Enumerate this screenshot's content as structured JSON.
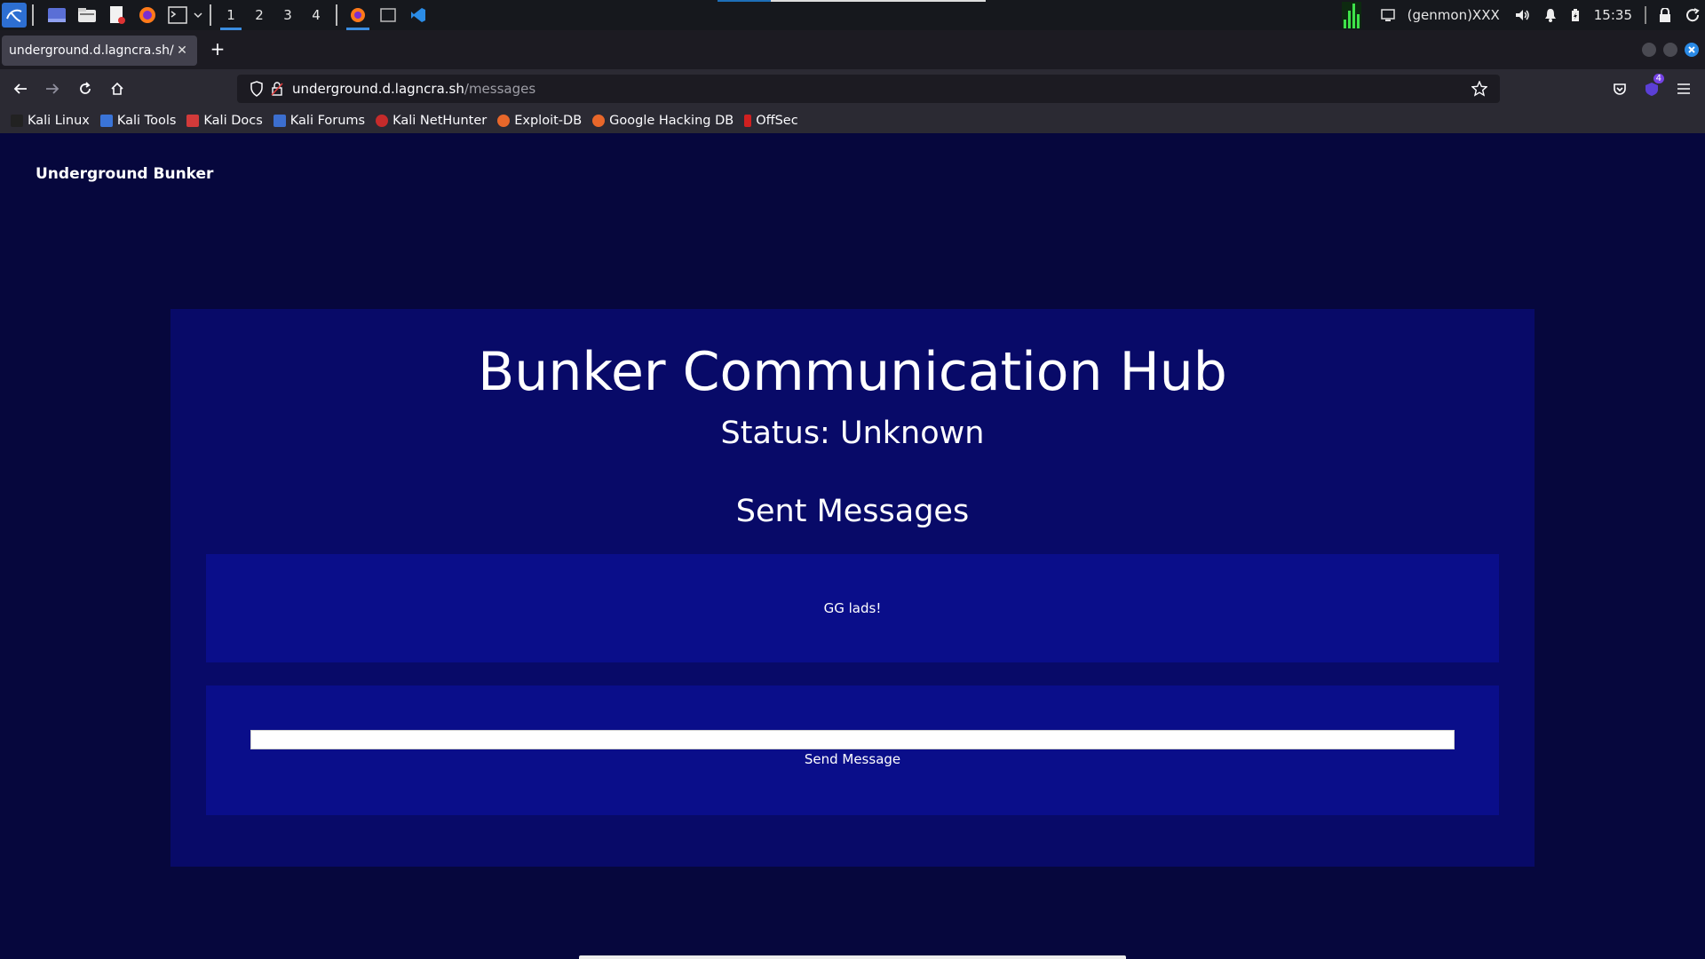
{
  "system_panel": {
    "workspaces": [
      "1",
      "2",
      "3",
      "4"
    ],
    "active_workspace": "1",
    "genmon_label": "(genmon)XXX",
    "clock": "15:35"
  },
  "browser": {
    "tab_title": "underground.d.lagncra.sh/messages",
    "url_host": "underground.d.lagncra.sh",
    "url_path": "/messages",
    "extension_badge": "4",
    "bookmarks": [
      "Kali Linux",
      "Kali Tools",
      "Kali Docs",
      "Kali Forums",
      "Kali NetHunter",
      "Exploit-DB",
      "Google Hacking DB",
      "OffSec"
    ]
  },
  "page": {
    "brand": "Underground Bunker",
    "title": "Bunker Communication Hub",
    "status": "Status: Unknown",
    "sent_heading": "Sent Messages",
    "messages": [
      "GG lads!"
    ],
    "input_value": "",
    "send_label": "Send Message"
  },
  "colors": {
    "page_bg": "#06073d",
    "hub_bg": "#080a68",
    "box_bg": "#0a0e8a"
  }
}
